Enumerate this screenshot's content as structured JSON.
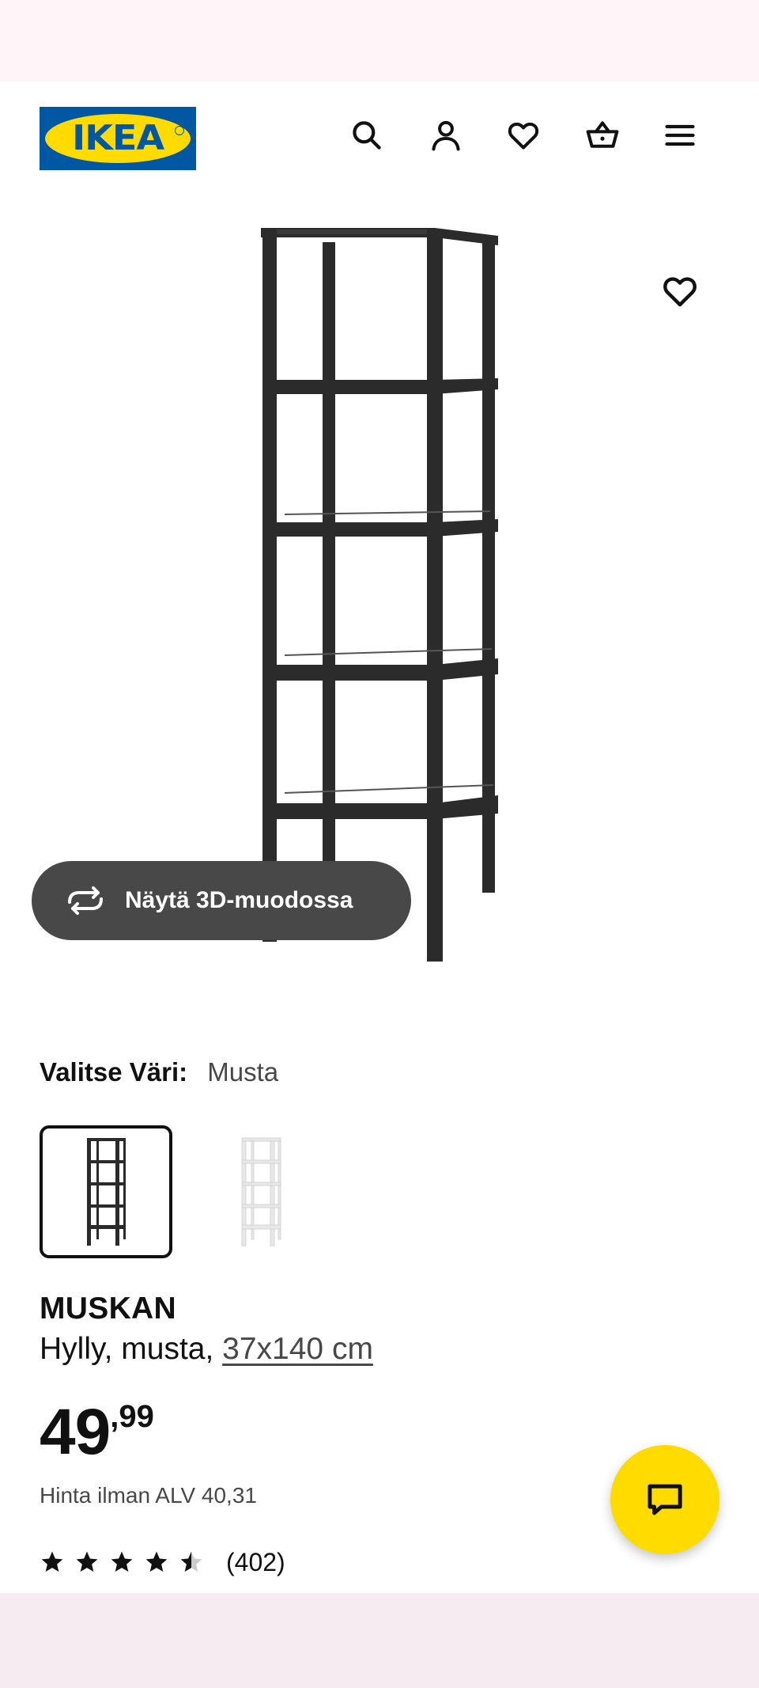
{
  "brand": {
    "logo_text": "IKEA",
    "yellow": "#ffdb00",
    "blue": "#0058a3"
  },
  "header": {
    "icons": [
      "search-icon",
      "account-icon",
      "favourites-icon",
      "basket-icon",
      "menu-icon"
    ]
  },
  "gallery": {
    "view_3d_label": "Näytä 3D-muodossa",
    "button_color": "#484848"
  },
  "color_picker": {
    "label": "Valitse Väri:",
    "selected_value": "Musta",
    "options": [
      "black",
      "white"
    ]
  },
  "product": {
    "name": "MUSKAN",
    "description_prefix": "Hylly, musta, ",
    "size": "37x140 cm",
    "price_integer": "49",
    "price_decimal": ",99",
    "vat_text": "Hinta ilman ALV 40,31",
    "rating_value": 4.5,
    "rating_max": 5,
    "review_count": "(402)"
  },
  "chat": {
    "icon": "chat-icon",
    "color": "#ffdb00"
  }
}
